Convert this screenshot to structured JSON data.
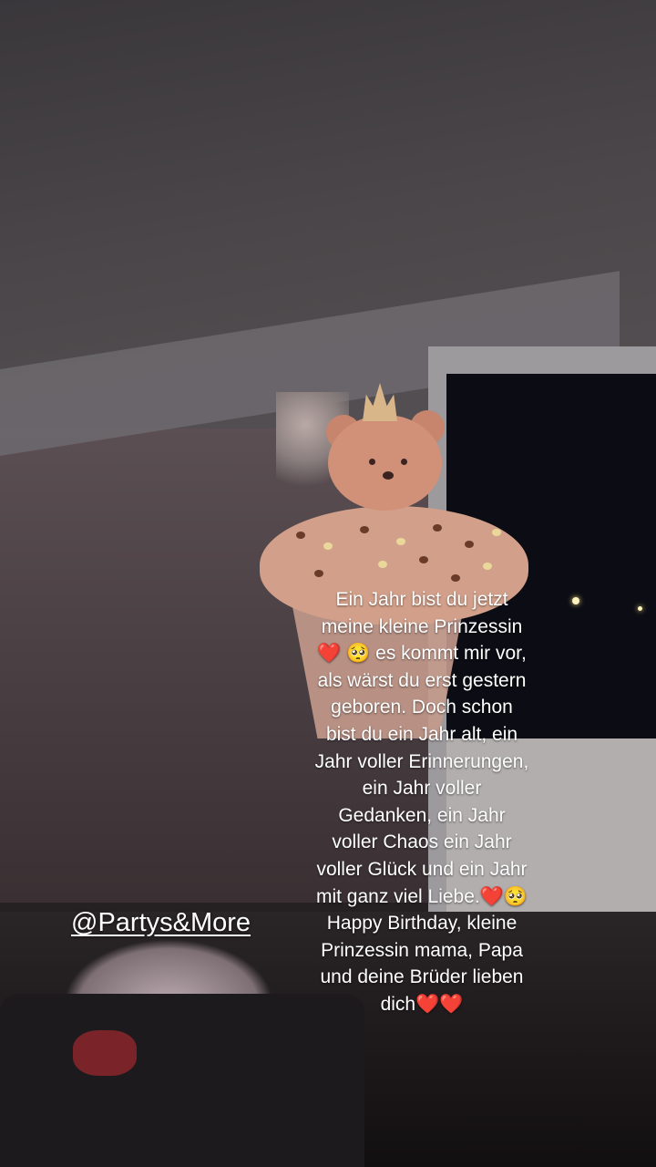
{
  "story": {
    "caption_lines": [
      "Ein Jahr bist du jetzt",
      "meine kleine Prinzessin",
      "❤️ 🥺 es kommt mir vor,",
      "als wärst du erst gestern",
      "geboren. Doch schon",
      "bist du ein Jahr alt, ein",
      "Jahr voller Erinnerungen,",
      "ein Jahr voller",
      "Gedanken, ein Jahr",
      "voller Chaos ein Jahr",
      "voller Glück  und ein Jahr",
      "mit ganz viel Liebe.❤️🥺",
      "Happy Birthday, kleine",
      "Prinzessin mama, Papa",
      "und deine Brüder lieben",
      "dich❤️❤️"
    ],
    "mention": "@Partys&More"
  },
  "photo": {
    "subject": "balloon-bear-cupcake-icon"
  }
}
